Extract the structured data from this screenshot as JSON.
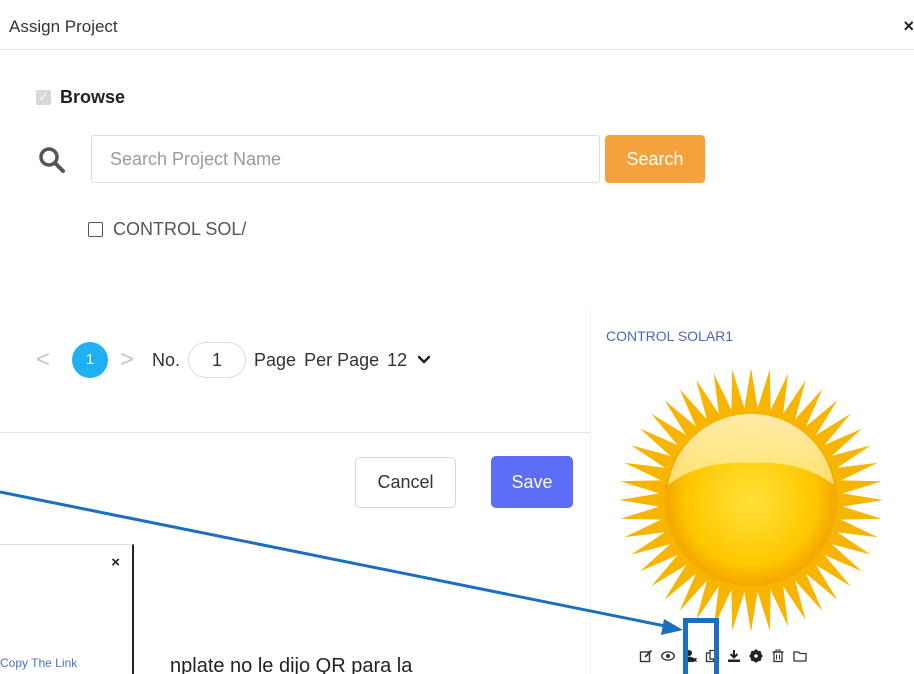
{
  "dialog": {
    "title": "Assign Project",
    "close": "×"
  },
  "browse": {
    "label": "Browse"
  },
  "search": {
    "placeholder": "Search Project Name",
    "button_label": "Search"
  },
  "projects": [
    {
      "label": "CONTROL SOL/"
    }
  ],
  "pagination": {
    "prev": "<",
    "current_page": "1",
    "next": ">",
    "no_label": "No.",
    "page_input_value": "1",
    "page_label": "Page",
    "per_page_label": "Per Page",
    "per_page_value": "12"
  },
  "footer": {
    "cancel_label": "Cancel",
    "save_label": "Save"
  },
  "project_card": {
    "title": "CONTROL SOLAR1",
    "actions": [
      "edit-icon",
      "eye-icon",
      "assign-user-icon",
      "copy-icon",
      "download-icon",
      "gear-icon",
      "trash-icon",
      "folder-icon"
    ]
  },
  "sub_dialog": {
    "close": "×",
    "copy_link": "Copy The Link"
  },
  "cut_text": "nplate no le dijo QR para la",
  "colors": {
    "accent_orange": "#f5a23c",
    "save_blue": "#5b6ef5",
    "page_cyan": "#1eb0f2",
    "annotation_blue": "#1a6fbf"
  }
}
